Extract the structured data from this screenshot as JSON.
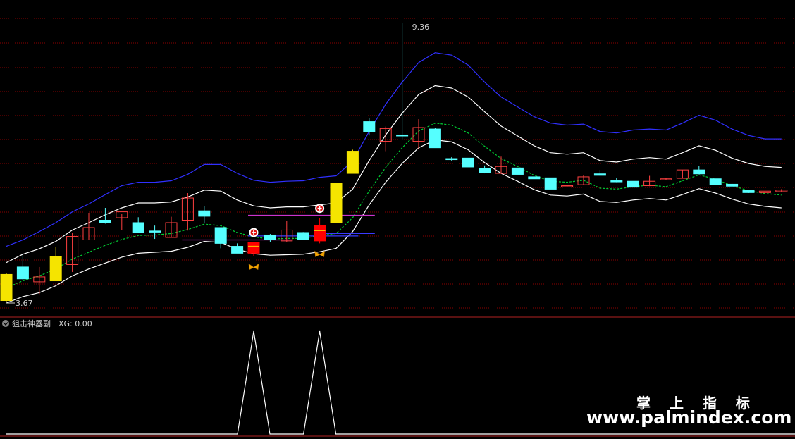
{
  "colors": {
    "background": "#000000",
    "grid": "#8b0000",
    "separator": "#b22222",
    "up_candle": "#ff4040",
    "down_candle": "#55ffff",
    "signal_yellow": "#f5e400",
    "signal_red": "#ff0000",
    "upper_band": "#3030ff",
    "middle_band": "#ffffff",
    "dashed_band": "#00cc33",
    "magenta_line": "#cc33cc",
    "blue_line": "#3a3aff",
    "sub_line": "#ffffff"
  },
  "labels": {
    "high_marker": "9.36",
    "low_marker": "3.67",
    "indicator_name": "狙击神器副",
    "indicator_value": "XG: 0.00",
    "watermark_cn": "掌 上 指 标",
    "watermark_url": "www.palmindex.com"
  },
  "chart_data": [
    {
      "type": "candlestick",
      "high_label": "9.36",
      "low_label": "3.67",
      "candles": [
        {
          "o": 4.25,
          "h": 4.28,
          "l": 3.7,
          "c": 3.72,
          "style": "yellow"
        },
        {
          "o": 4.4,
          "h": 4.65,
          "l": 4.14,
          "c": 4.16,
          "style": "down"
        },
        {
          "o": 4.1,
          "h": 4.4,
          "l": 3.85,
          "c": 4.2,
          "style": "up"
        },
        {
          "o": 4.62,
          "h": 4.8,
          "l": 4.12,
          "c": 4.12,
          "style": "yellow"
        },
        {
          "o": 4.45,
          "h": 5.1,
          "l": 4.3,
          "c": 5.02,
          "style": "up"
        },
        {
          "o": 4.95,
          "h": 5.5,
          "l": 4.95,
          "c": 5.2,
          "style": "up"
        },
        {
          "o": 5.35,
          "h": 5.6,
          "l": 5.28,
          "c": 5.3,
          "style": "down"
        },
        {
          "o": 5.4,
          "h": 5.48,
          "l": 5.15,
          "c": 5.52,
          "style": "up"
        },
        {
          "o": 5.3,
          "h": 5.41,
          "l": 5.12,
          "c": 5.1,
          "style": "down"
        },
        {
          "o": 5.11,
          "h": 5.24,
          "l": 4.97,
          "c": 5.13,
          "style": "down"
        },
        {
          "o": 5.0,
          "h": 5.42,
          "l": 5.0,
          "c": 5.3,
          "style": "up"
        },
        {
          "o": 5.35,
          "h": 5.9,
          "l": 5.14,
          "c": 5.8,
          "style": "up"
        },
        {
          "o": 5.54,
          "h": 5.63,
          "l": 5.3,
          "c": 5.43,
          "style": "down"
        },
        {
          "o": 5.2,
          "h": 5.2,
          "l": 4.78,
          "c": 4.88,
          "style": "down"
        },
        {
          "o": 4.82,
          "h": 4.88,
          "l": 4.68,
          "c": 4.68,
          "style": "down"
        },
        {
          "o": 4.68,
          "h": 4.9,
          "l": 4.62,
          "c": 4.9,
          "style": "red"
        },
        {
          "o": 5.05,
          "h": 5.07,
          "l": 4.9,
          "c": 4.95,
          "style": "down"
        },
        {
          "o": 4.93,
          "h": 5.33,
          "l": 4.9,
          "c": 5.15,
          "style": "up"
        },
        {
          "o": 5.1,
          "h": 5.11,
          "l": 4.95,
          "c": 4.96,
          "style": "down"
        },
        {
          "o": 4.93,
          "h": 5.39,
          "l": 4.88,
          "c": 5.25,
          "style": "red"
        },
        {
          "o": 5.3,
          "h": 6.1,
          "l": 5.3,
          "c": 6.1,
          "style": "yellow"
        },
        {
          "o": 6.75,
          "h": 6.78,
          "l": 6.3,
          "c": 6.3,
          "style": "yellow"
        },
        {
          "o": 7.15,
          "h": 7.43,
          "l": 7.07,
          "c": 7.35,
          "style": "down"
        },
        {
          "o": 6.95,
          "h": 7.25,
          "l": 6.75,
          "c": 7.21,
          "style": "up"
        },
        {
          "o": 7.08,
          "h": 7.54,
          "l": 6.99,
          "c": 7.06,
          "style": "down"
        },
        {
          "o": 6.95,
          "h": 7.4,
          "l": 6.8,
          "c": 7.23,
          "style": "up"
        },
        {
          "o": 7.2,
          "h": 7.22,
          "l": 6.82,
          "c": 6.82,
          "style": "down"
        },
        {
          "o": 6.6,
          "h": 6.63,
          "l": 6.55,
          "c": 6.58,
          "style": "down"
        },
        {
          "o": 6.61,
          "h": 6.61,
          "l": 6.43,
          "c": 6.43,
          "style": "down"
        },
        {
          "o": 6.4,
          "h": 6.46,
          "l": 6.3,
          "c": 6.32,
          "style": "down"
        },
        {
          "o": 6.3,
          "h": 6.64,
          "l": 6.3,
          "c": 6.44,
          "style": "up"
        },
        {
          "o": 6.41,
          "h": 6.41,
          "l": 6.29,
          "c": 6.28,
          "style": "down"
        },
        {
          "o": 6.23,
          "h": 6.23,
          "l": 6.19,
          "c": 6.19,
          "style": "down"
        },
        {
          "o": 6.21,
          "h": 6.21,
          "l": 5.98,
          "c": 5.98,
          "style": "down"
        },
        {
          "o": 6.04,
          "h": 6.06,
          "l": 6.02,
          "c": 6.05,
          "style": "up"
        },
        {
          "o": 6.07,
          "h": 6.27,
          "l": 6.06,
          "c": 6.23,
          "style": "up"
        },
        {
          "o": 6.29,
          "h": 6.37,
          "l": 6.25,
          "c": 6.26,
          "style": "down"
        },
        {
          "o": 6.15,
          "h": 6.21,
          "l": 6.12,
          "c": 6.14,
          "style": "down"
        },
        {
          "o": 6.14,
          "h": 6.14,
          "l": 6.02,
          "c": 6.02,
          "style": "down"
        },
        {
          "o": 6.05,
          "h": 6.25,
          "l": 6.04,
          "c": 6.14,
          "style": "up"
        },
        {
          "o": 6.19,
          "h": 6.21,
          "l": 6.17,
          "c": 6.19,
          "style": "up"
        },
        {
          "o": 6.2,
          "h": 6.37,
          "l": 6.2,
          "c": 6.37,
          "style": "up"
        },
        {
          "o": 6.37,
          "h": 6.45,
          "l": 6.28,
          "c": 6.29,
          "style": "down"
        },
        {
          "o": 6.19,
          "h": 6.19,
          "l": 6.07,
          "c": 6.07,
          "style": "down"
        },
        {
          "o": 6.08,
          "h": 6.09,
          "l": 6.04,
          "c": 6.04,
          "style": "down"
        },
        {
          "o": 5.95,
          "h": 5.95,
          "l": 5.9,
          "c": 5.91,
          "style": "down"
        },
        {
          "o": 5.91,
          "h": 5.94,
          "l": 5.88,
          "c": 5.94,
          "style": "up"
        },
        {
          "o": 5.93,
          "h": 5.98,
          "l": 5.93,
          "c": 5.96,
          "style": "up"
        }
      ],
      "bands": {
        "upper": [
          4.82,
          4.95,
          5.12,
          5.3,
          5.52,
          5.68,
          5.87,
          6.05,
          6.12,
          6.12,
          6.15,
          6.28,
          6.48,
          6.48,
          6.3,
          6.16,
          6.12,
          6.14,
          6.15,
          6.22,
          6.25,
          6.55,
          7.15,
          7.7,
          8.15,
          8.55,
          8.75,
          8.7,
          8.5,
          8.15,
          7.85,
          7.65,
          7.45,
          7.32,
          7.28,
          7.3,
          7.15,
          7.12,
          7.18,
          7.2,
          7.18,
          7.32,
          7.48,
          7.38,
          7.2,
          7.07,
          7.0,
          7.0
        ],
        "middle": [
          4.49,
          4.66,
          4.77,
          4.92,
          5.15,
          5.3,
          5.46,
          5.6,
          5.7,
          5.7,
          5.72,
          5.82,
          5.96,
          5.94,
          5.76,
          5.64,
          5.6,
          5.62,
          5.62,
          5.66,
          5.7,
          5.98,
          6.56,
          7.08,
          7.52,
          7.9,
          8.08,
          8.03,
          7.85,
          7.55,
          7.26,
          7.06,
          6.86,
          6.72,
          6.69,
          6.72,
          6.56,
          6.53,
          6.59,
          6.62,
          6.59,
          6.72,
          6.86,
          6.77,
          6.61,
          6.5,
          6.44,
          6.42
        ],
        "dashed": [
          3.98,
          4.12,
          4.22,
          4.36,
          4.56,
          4.7,
          4.84,
          4.96,
          5.04,
          5.05,
          5.08,
          5.16,
          5.27,
          5.24,
          5.1,
          5.01,
          4.97,
          4.98,
          4.98,
          5.04,
          5.08,
          5.4,
          5.94,
          6.42,
          6.82,
          7.16,
          7.32,
          7.28,
          7.12,
          6.85,
          6.6,
          6.44,
          6.26,
          6.14,
          6.12,
          6.16,
          6.0,
          5.98,
          6.03,
          6.06,
          6.03,
          6.15,
          6.27,
          6.18,
          6.05,
          5.95,
          5.89,
          5.86
        ],
        "lower": [
          3.67,
          3.8,
          3.88,
          4.02,
          4.22,
          4.36,
          4.48,
          4.6,
          4.68,
          4.7,
          4.72,
          4.8,
          4.92,
          4.9,
          4.76,
          4.67,
          4.64,
          4.65,
          4.66,
          4.71,
          4.78,
          5.12,
          5.66,
          6.12,
          6.5,
          6.82,
          6.98,
          6.94,
          6.78,
          6.52,
          6.3,
          6.14,
          5.97,
          5.86,
          5.84,
          5.88,
          5.73,
          5.71,
          5.76,
          5.79,
          5.76,
          5.87,
          5.99,
          5.9,
          5.78,
          5.68,
          5.63,
          5.6
        ]
      },
      "signals": [
        {
          "index": 15,
          "type": "buy"
        },
        {
          "index": 19,
          "type": "buy"
        }
      ],
      "reference_lines": [
        {
          "color": "magenta",
          "from": 11,
          "to": 17,
          "y": 4.95
        },
        {
          "color": "magenta",
          "from": 15,
          "to": 22,
          "y": 5.45
        },
        {
          "color": "blue",
          "from": 15,
          "to": 21,
          "y": 5.03
        },
        {
          "color": "blue",
          "from": 19,
          "to": 22,
          "y": 5.08
        }
      ]
    },
    {
      "type": "line",
      "name": "XG",
      "spikes": [
        15,
        19
      ],
      "values_range": [
        0,
        1
      ]
    }
  ]
}
